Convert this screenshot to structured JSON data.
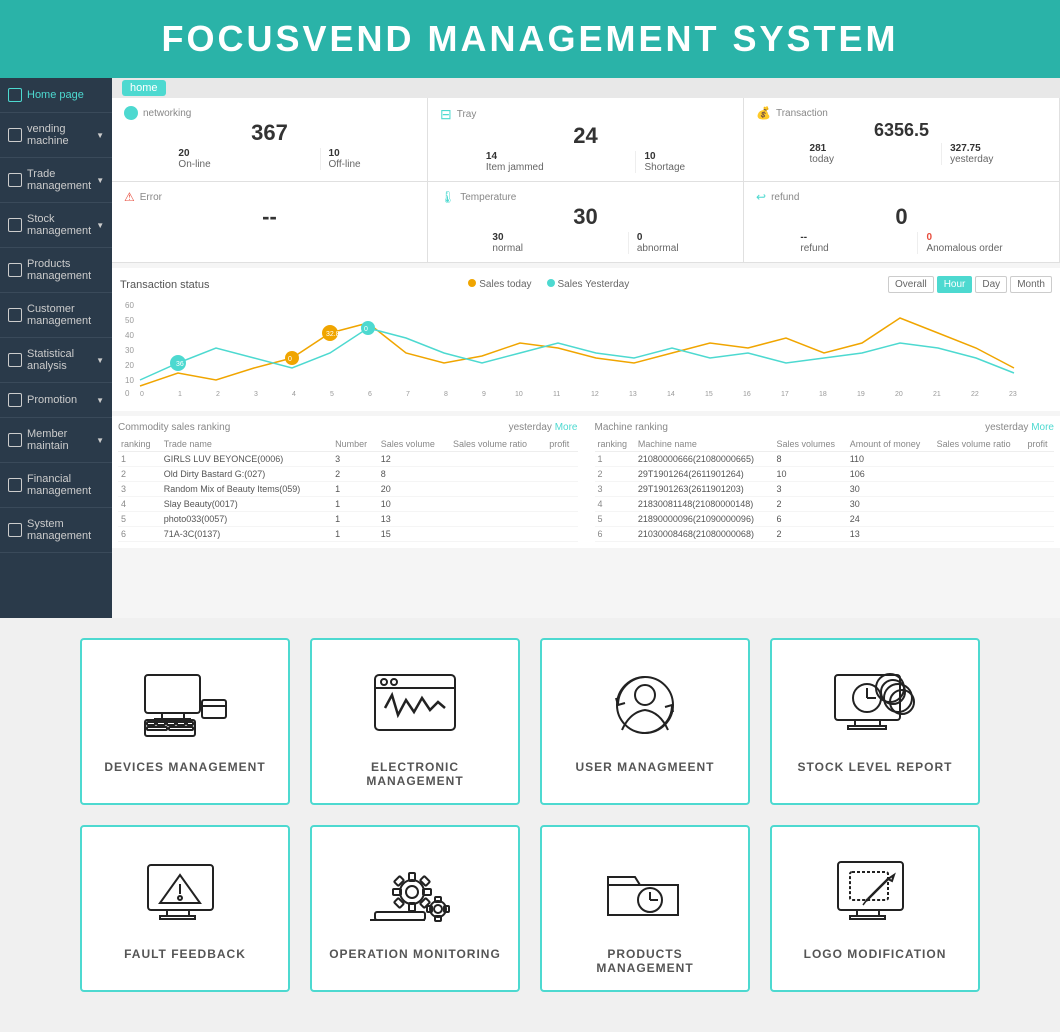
{
  "header": {
    "title": "FOCUSVEND MANAGEMENT SYSTEM"
  },
  "sidebar": {
    "items": [
      {
        "label": "Home page",
        "active": true
      },
      {
        "label": "vending machine",
        "hasArrow": true
      },
      {
        "label": "Trade management",
        "hasArrow": true
      },
      {
        "label": "Stock management",
        "hasArrow": true
      },
      {
        "label": "Products management"
      },
      {
        "label": "Customer management"
      },
      {
        "label": "Statistical analysis",
        "hasArrow": true
      },
      {
        "label": "Promotion",
        "hasArrow": true
      },
      {
        "label": "Member maintain",
        "hasArrow": true
      },
      {
        "label": "Financial management"
      },
      {
        "label": "System management"
      }
    ]
  },
  "breadcrumb": "home",
  "statusCards": {
    "networking": {
      "title": "networking",
      "mainNumber": "367",
      "stats": [
        {
          "label": "On-line",
          "value": "20"
        },
        {
          "label": "Off-line",
          "value": "10"
        }
      ]
    },
    "tray": {
      "title": "Tray",
      "mainNumber": "24",
      "stats": [
        {
          "label": "Item jammed",
          "value": "14"
        },
        {
          "label": "Shortage",
          "value": "10"
        }
      ]
    },
    "transaction": {
      "title": "Transaction",
      "mainNumber": "6356.5",
      "stats": [
        {
          "label": "today",
          "value": "281"
        },
        {
          "label": "yesterday",
          "value": "327.75"
        }
      ]
    },
    "error": {
      "title": "Error",
      "mainValue": "--"
    },
    "temperature": {
      "title": "Temperature",
      "mainNumber": "30",
      "stats": [
        {
          "label": "normal",
          "value": "30"
        },
        {
          "label": "abnormal",
          "value": "0"
        }
      ]
    },
    "refund": {
      "title": "refund",
      "mainNumber": "0",
      "stats": [
        {
          "label": "refund",
          "value": "--"
        },
        {
          "label": "Anomalous order",
          "value": "0"
        }
      ]
    }
  },
  "chart": {
    "title": "Transaction status",
    "legendToday": "Sales today",
    "legendYesterday": "Sales Yesterday",
    "tabs": [
      "Overall",
      "Hour",
      "Day",
      "Month"
    ],
    "activeTab": "Hour",
    "colorToday": "#f0a500",
    "colorYesterday": "#4dd9d0"
  },
  "commodityTable": {
    "title": "Commodity sales ranking",
    "yesterday": "yesterday",
    "more": "More",
    "columns": [
      "ranking",
      "Trade name",
      "Number",
      "Sales volume",
      "Sales volume ratio",
      "profit"
    ],
    "rows": [
      [
        1,
        "GIRLS LUV BEYONCE(0006)",
        3,
        12,
        "",
        ""
      ],
      [
        2,
        "Old Dirty Bastard G:(027)",
        2,
        8,
        "",
        ""
      ],
      [
        3,
        "Random Mix of Beauty Items(059)",
        1,
        20,
        "",
        ""
      ],
      [
        4,
        "Slay Beauty(0017)",
        1,
        10,
        "",
        ""
      ],
      [
        5,
        "photo033(0057)",
        1,
        13,
        "",
        ""
      ],
      [
        6,
        "71A-3C(0137)",
        1,
        15,
        "",
        ""
      ]
    ]
  },
  "machineTable": {
    "title": "Machine ranking",
    "yesterday": "yesterday",
    "more": "More",
    "columns": [
      "ranking",
      "Machine name",
      "Sales volumes",
      "Amount of money",
      "Sales volume ratio",
      "profit"
    ],
    "rows": [
      [
        1,
        "21080000666(21080000665)",
        8,
        110,
        "",
        ""
      ],
      [
        2,
        "29T1901264(2611901264)",
        10,
        106,
        "",
        ""
      ],
      [
        3,
        "29T1901263(2611901203)",
        3,
        30,
        "",
        ""
      ],
      [
        4,
        "21830081148(21080000148)",
        2,
        30,
        "",
        ""
      ],
      [
        5,
        "21890000096(21090000096)",
        6,
        24,
        "",
        ""
      ],
      [
        6,
        "21030008468(21080000068)",
        2,
        13,
        "",
        ""
      ]
    ]
  },
  "featureCards": {
    "row1": [
      {
        "id": "devices",
        "label": "DEVICES MANAGEMENT"
      },
      {
        "id": "electronic",
        "label": "ELECTRONIC MANAGEMENT"
      },
      {
        "id": "user",
        "label": "USER MANAGMEENT"
      },
      {
        "id": "stock",
        "label": "STOCK LEVEL REPORT"
      }
    ],
    "row2": [
      {
        "id": "fault",
        "label": "FAULT FEEDBACK"
      },
      {
        "id": "operation",
        "label": "OPERATION MONITORING"
      },
      {
        "id": "products",
        "label": "PRODUCTS MANAGEMENT"
      },
      {
        "id": "logo",
        "label": "LOGO MODIFICATION"
      }
    ]
  }
}
